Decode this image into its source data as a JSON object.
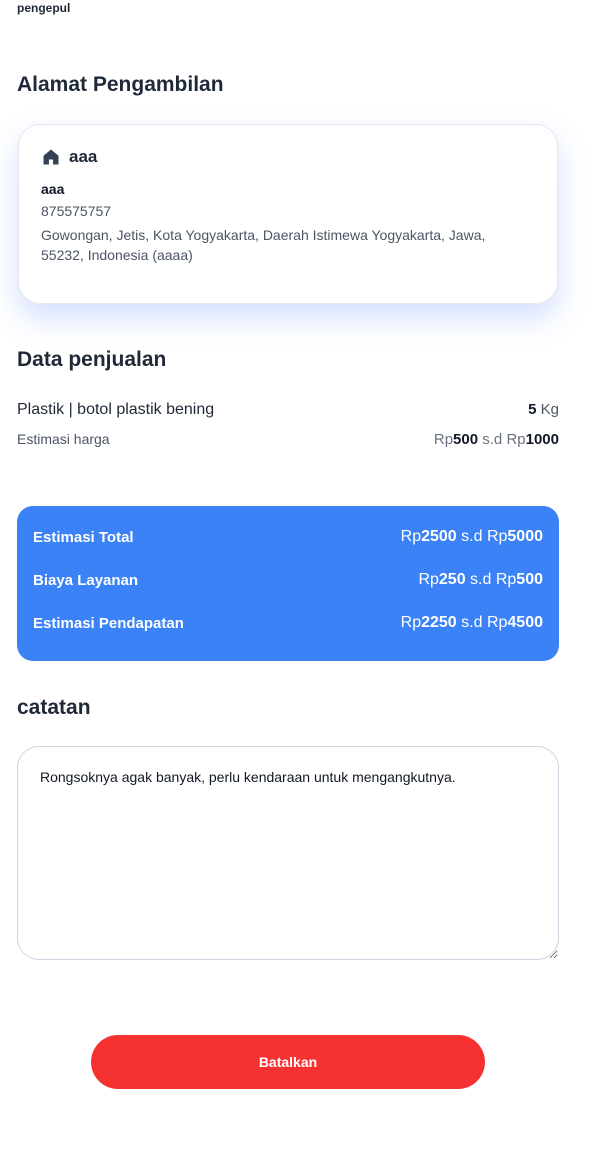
{
  "top_label": "pengepul",
  "address_section": {
    "title": "Alamat Pengambilan",
    "label_name": "aaa",
    "recipient": "aaa",
    "phone": "875575757",
    "full_address": "Gowongan, Jetis, Kota Yogyakarta, Daerah Istimewa Yogyakarta, Jawa, 55232, Indonesia (aaaa)",
    "icon": "home-icon"
  },
  "sales_section": {
    "title": "Data penjualan",
    "item_label": "Plastik | botol plastik bening",
    "qty_value": "5",
    "qty_unit": "Kg",
    "estimate_label": "Estimasi harga",
    "estimate": {
      "prefix1": "Rp",
      "min": "500",
      "sep": "s.d",
      "prefix2": "Rp",
      "max": "1000"
    }
  },
  "summary": {
    "color": "#3b82f6",
    "rows": [
      {
        "label": "Estimasi Total",
        "prefix1": "Rp",
        "min": "2500",
        "sep": "s.d",
        "prefix2": "Rp",
        "max": "5000"
      },
      {
        "label": "Biaya Layanan",
        "prefix1": "Rp",
        "min": "250",
        "sep": "s.d",
        "prefix2": "Rp",
        "max": "500"
      },
      {
        "label": "Estimasi Pendapatan",
        "prefix1": "Rp",
        "min": "2250",
        "sep": "s.d",
        "prefix2": "Rp",
        "max": "4500"
      }
    ]
  },
  "notes_section": {
    "title": "catatan",
    "value": "Rongsoknya agak banyak, perlu kendaraan untuk mengangkutnya."
  },
  "actions": {
    "cancel_label": "Batalkan",
    "cancel_color": "#f53131"
  }
}
